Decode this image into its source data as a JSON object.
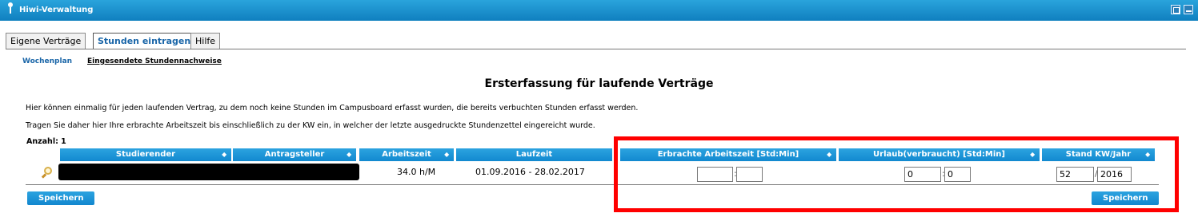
{
  "window": {
    "title": "Hiwi-Verwaltung"
  },
  "tabs": [
    "Eigene Verträge",
    "Stunden eintragen",
    "Hilfe"
  ],
  "subnav": [
    "Wochenplan",
    "Eingesendete Stundennachweise"
  ],
  "page": {
    "title": "Ersterfassung für laufende Verträge",
    "intro1": "Hier können einmalig für jeden laufenden Vertrag, zu dem noch keine Stunden im Campusboard erfasst wurden, die bereits verbuchten Stunden erfasst werden.",
    "intro2": "Tragen Sie daher hier Ihre erbrachte Arbeitszeit bis einschließlich zu der KW ein, in welcher der letzte ausgedruckte Stundenzettel eingereicht wurde.",
    "count_label": "Anzahl: 1"
  },
  "table": {
    "columns": [
      "Studierender",
      "Antragsteller",
      "Arbeitszeit",
      "Laufzeit",
      "Erbrachte Arbeitszeit [Std:Min]",
      "Urlaub(verbraucht) [Std:Min]",
      "Stand KW/Jahr"
    ],
    "sort_glyph": "⬥",
    "row": {
      "arbeitszeit": "34.0 h/M",
      "laufzeit": "01.09.2016 - 28.02.2017",
      "erbracht_std": "",
      "erbracht_min": "",
      "urlaub_std": "0",
      "urlaub_min": "0",
      "stand_kw": "52",
      "stand_jahr": "2016",
      "time_sep": ":",
      "kw_sep": "/"
    }
  },
  "buttons": {
    "save": "Speichern"
  }
}
